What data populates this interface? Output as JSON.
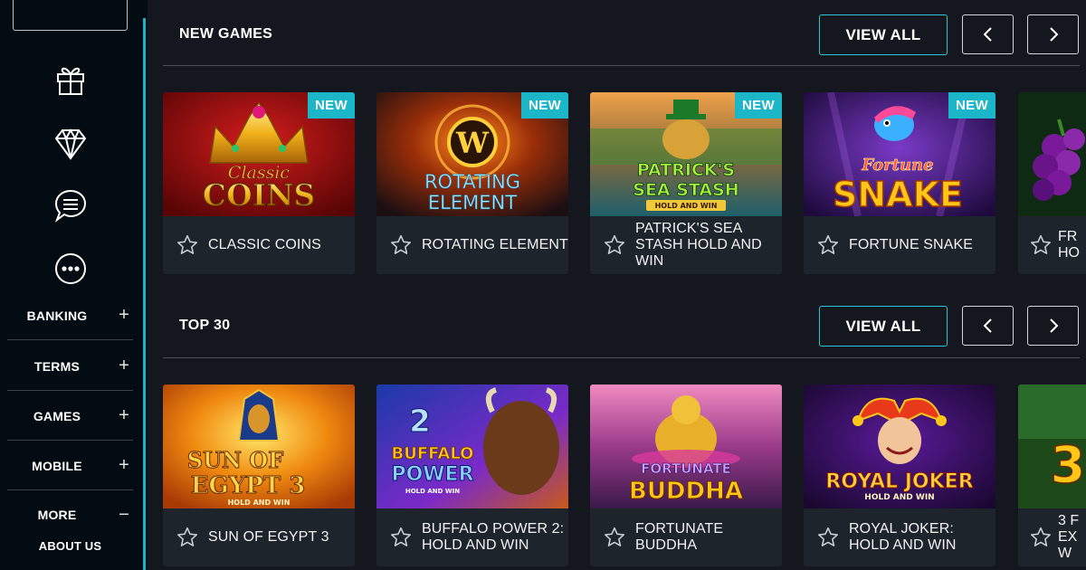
{
  "sidebar": {
    "menu": [
      {
        "label": "BANKING",
        "sign": "+"
      },
      {
        "label": "TERMS",
        "sign": "+"
      },
      {
        "label": "GAMES",
        "sign": "+"
      },
      {
        "label": "MOBILE",
        "sign": "+"
      },
      {
        "label": "MORE",
        "sign": "−"
      }
    ],
    "sub_link": "ABOUT US",
    "icons": [
      "gift-icon",
      "diamond-icon",
      "chat-icon",
      "more-icon"
    ],
    "accent_color": "#1bb3c7"
  },
  "sections": [
    {
      "title": "NEW GAMES",
      "view_all": "VIEW ALL",
      "cards": [
        {
          "title": "CLASSIC COINS",
          "badge": "NEW",
          "art_lines": [
            "Classic",
            "COINS"
          ]
        },
        {
          "title": "ROTATING ELEMENT",
          "badge": "NEW",
          "art_lines": [
            "W",
            "ROTATING",
            "ELEMENT"
          ]
        },
        {
          "title": "PATRICK'S SEA STASH HOLD AND WIN",
          "badge": "NEW",
          "art_lines": [
            "PATRICK'S",
            "SEA STASH",
            "HOLD AND WIN"
          ]
        },
        {
          "title": "FORTUNE SNAKE",
          "badge": "NEW",
          "art_lines": [
            "Fortune",
            "SNAKE"
          ]
        }
      ],
      "partial_title": "FR HO"
    },
    {
      "title": "TOP 30",
      "view_all": "VIEW ALL",
      "cards": [
        {
          "title": "SUN OF EGYPT 3",
          "art_lines": [
            "SUN OF",
            "EGYPT 3",
            "HOLD AND WIN"
          ]
        },
        {
          "title": "BUFFALO POWER 2: HOLD AND WIN",
          "art_lines": [
            "2",
            "BUFFALO",
            "POWER",
            "HOLD AND WIN"
          ]
        },
        {
          "title": "FORTUNATE BUDDHA",
          "art_lines": [
            "FORTUNATE",
            "BUDDHA"
          ]
        },
        {
          "title": "ROYAL JOKER: HOLD AND WIN",
          "art_lines": [
            "ROYAL JOKER",
            "HOLD AND WIN"
          ]
        }
      ],
      "partial_title": "3 F EX W"
    }
  ],
  "colors": {
    "accent": "#1cb6c9",
    "background": "#14171d",
    "sidebar": "#030b13",
    "card": "#1e242c"
  }
}
